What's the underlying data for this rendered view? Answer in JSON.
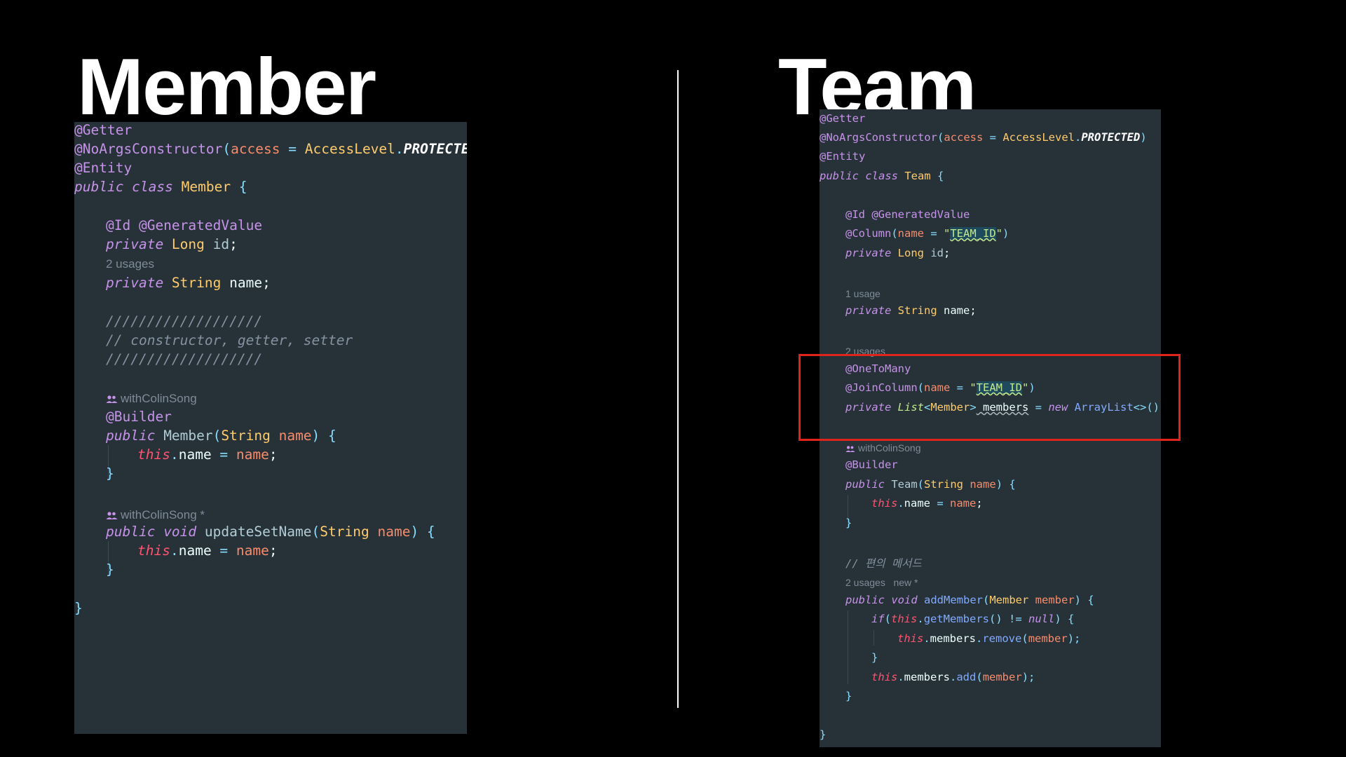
{
  "slide": {
    "left_title": "Member",
    "right_title": "Team"
  },
  "member_code": {
    "l1": "@Getter",
    "l2a": "@NoArgsConstructor",
    "l2b": "(",
    "l2c": "access",
    "l2d": " = ",
    "l2e": "AccessLevel",
    "l2f": ".",
    "l2g": "PROTECTED",
    "l2h": ")",
    "l3": "@Entity",
    "l4a": "public class",
    "l4b": " Member",
    "l4c": " {",
    "l5": "@Id @GeneratedValue",
    "l6a": "private",
    "l6b": " Long",
    "l6c": " id",
    "l6d": ";",
    "l7": "2 usages",
    "l8a": "private",
    "l8b": " String",
    "l8c": " name",
    "l8d": ";",
    "l9": "///////////////////",
    "l10": "// constructor, getter, setter",
    "l11": "///////////////////",
    "l12": "withColinSong",
    "l13": "@Builder",
    "l14a": "public",
    "l14b": " Member",
    "l14c": "(",
    "l14d": "String",
    "l14e": " name",
    "l14f": ") {",
    "l15a": "this",
    "l15b": ".",
    "l15c": "name",
    "l15d": " = ",
    "l15e": "name",
    "l15f": ";",
    "l16": "}",
    "l17": "withColinSong *",
    "l18a": "public",
    "l18b": " void",
    "l18c": " updateSetName",
    "l18d": "(",
    "l18e": "String",
    "l18f": " name",
    "l18g": ") {",
    "l19a": "this",
    "l19b": ".",
    "l19c": "name",
    "l19d": " = ",
    "l19e": "name",
    "l19f": ";",
    "l20": "}",
    "l21": "}"
  },
  "team_code": {
    "l1": "@Getter",
    "l2a": "@NoArgsConstructor",
    "l2b": "(",
    "l2c": "access",
    "l2d": " = ",
    "l2e": "AccessLevel",
    "l2f": ".",
    "l2g": "PROTECTED",
    "l2h": ")",
    "l3": "@Entity",
    "l4a": "public class",
    "l4b": " Team",
    "l4c": " {",
    "l5": "@Id @GeneratedValue",
    "l6a": "@Column",
    "l6b": "(",
    "l6c": "name",
    "l6d": " = ",
    "l6e": "\"",
    "l6f": "TEAM_ID",
    "l6g": "\"",
    "l6h": ")",
    "l7a": "private",
    "l7b": " Long",
    "l7c": " id",
    "l7d": ";",
    "l8": "1 usage",
    "l9a": "private",
    "l9b": " String",
    "l9c": " name",
    "l9d": ";",
    "l10": "2 usages",
    "l11": "@OneToMany",
    "l12a": "@JoinColumn",
    "l12b": "(",
    "l12c": "name",
    "l12d": " = ",
    "l12e": "\"",
    "l12f": "TEAM_ID",
    "l12g": "\"",
    "l12h": ")",
    "l13a": "private",
    "l13b": " List",
    "l13c": "<",
    "l13d": "Member",
    "l13e": ">",
    "l13f": " members",
    "l13g": " = ",
    "l13h": "new",
    "l13i": " ArrayList",
    "l13j": "<>();",
    "l14": "withColinSong",
    "l15": "@Builder",
    "l16a": "public",
    "l16b": " Team",
    "l16c": "(",
    "l16d": "String",
    "l16e": " name",
    "l16f": ") {",
    "l17a": "this",
    "l17b": ".",
    "l17c": "name",
    "l17d": " = ",
    "l17e": "name",
    "l17f": ";",
    "l18": "}",
    "l19": "// 편의 메서드",
    "l20": "2 usages   new *",
    "l21a": "public",
    "l21b": " void",
    "l21c": " addMember",
    "l21d": "(",
    "l21e": "Member",
    "l21f": " member",
    "l21g": ") {",
    "l22a": "if",
    "l22b": "(",
    "l22c": "this",
    "l22d": ".",
    "l22e": "getMembers",
    "l22f": "() != ",
    "l22g": "null",
    "l22h": ") {",
    "l23a": "this",
    "l23b": ".",
    "l23c": "members",
    "l23d": ".",
    "l23e": "remove",
    "l23f": "(",
    "l23g": "member",
    "l23h": ");",
    "l24": "}",
    "l25a": "this",
    "l25b": ".",
    "l25c": "members",
    "l25d": ".",
    "l25e": "add",
    "l25f": "(",
    "l25g": "member",
    "l25h": ");",
    "l26": "}",
    "l27": "}"
  },
  "colors": {
    "background": "#000000",
    "editor_bg": "#263238",
    "highlight_border": "#e0241b"
  },
  "icons": {
    "author": "users-icon"
  }
}
